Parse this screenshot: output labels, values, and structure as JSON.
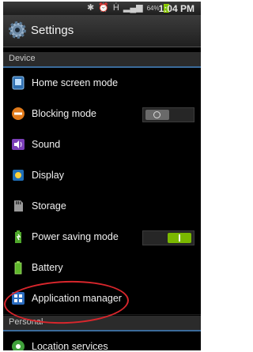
{
  "status_bar": {
    "time": "1:04 PM",
    "battery": "64%"
  },
  "title": "Settings",
  "sections": {
    "device": "Device",
    "personal": "Personal"
  },
  "items": [
    {
      "label": "Home screen mode"
    },
    {
      "label": "Blocking mode",
      "toggle": "off"
    },
    {
      "label": "Sound"
    },
    {
      "label": "Display"
    },
    {
      "label": "Storage"
    },
    {
      "label": "Power saving mode",
      "toggle": "on"
    },
    {
      "label": "Battery"
    },
    {
      "label": "Application manager"
    },
    {
      "label": "Location services"
    }
  ],
  "colors": {
    "section_accent": "#3b6b9b",
    "annotation_circle": "#d8262c",
    "toggle_on": "#7ab800"
  }
}
